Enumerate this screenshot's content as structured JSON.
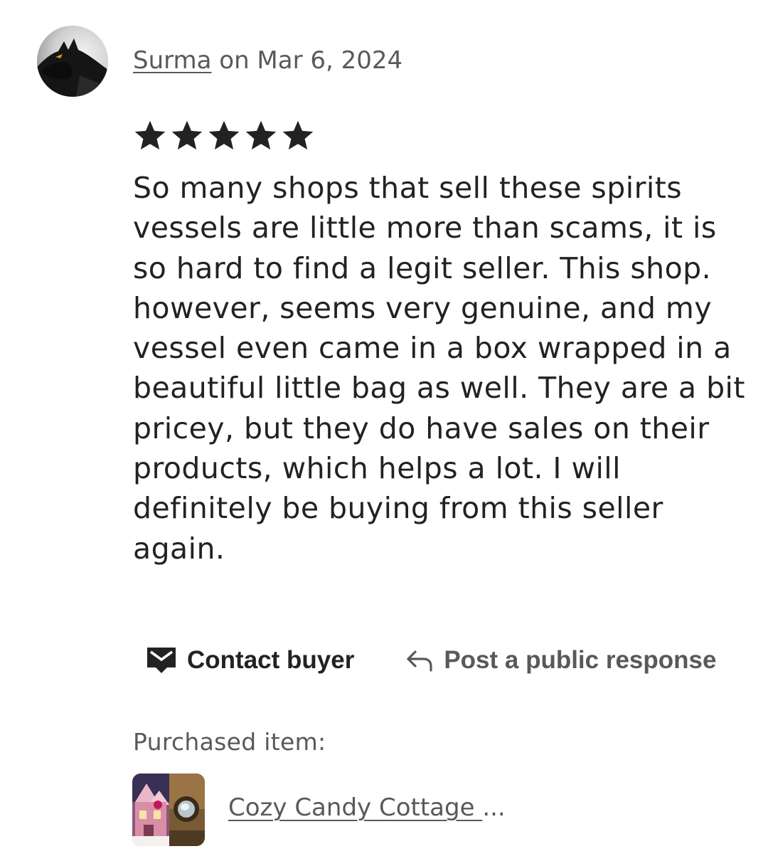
{
  "review": {
    "author": "Surma",
    "date_text": " on Mar 6, 2024",
    "rating": 5,
    "rating_max": 5,
    "text": "So many shops that sell these spirits vessels are little more than scams, it is so hard to find a legit seller. This shop. however, seems very genuine, and my vessel even came in a box wrapped in a beautiful little bag as well. They are a bit pricey, but they do have sales on their products, which helps a lot. I will definitely be buying from this seller again."
  },
  "actions": {
    "contact_label": "Contact buyer",
    "contact_icon": "envelope-icon",
    "respond_label": "Post a public response",
    "respond_icon": "reply-arrow-icon"
  },
  "purchase": {
    "label": "Purchased item:",
    "item_title": "Cozy Candy Cottage ",
    "ellipsis": "..."
  },
  "colors": {
    "text_primary": "#222222",
    "text_secondary": "#595959",
    "star": "#222222"
  }
}
